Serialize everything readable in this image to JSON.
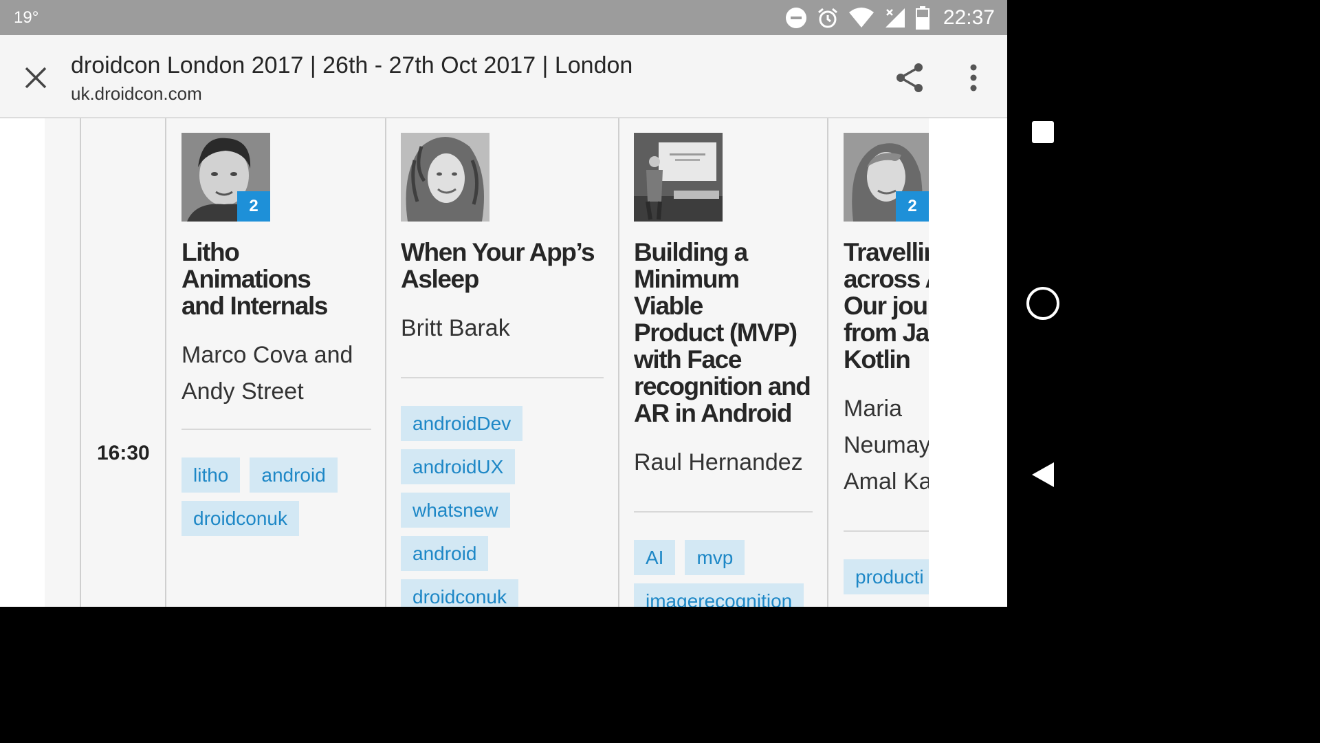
{
  "status_bar": {
    "temperature": "19°",
    "time": "22:37"
  },
  "browser": {
    "title": "droidcon London 2017 | 26th - 27th Oct 2017 | London",
    "url": "uk.droidcon.com"
  },
  "schedule": {
    "time": "16:30",
    "sessions": [
      {
        "title_lines": [
          "Litho Animations",
          "and Internals"
        ],
        "speaker_lines": [
          "Marco Cova and",
          "Andy Street"
        ],
        "badge": "2",
        "tags": [
          "litho",
          "android",
          "droidconuk"
        ]
      },
      {
        "title_lines": [
          "When Your App’s",
          "Asleep"
        ],
        "speaker_lines": [
          "Britt Barak"
        ],
        "badge": "",
        "tags": [
          "androidDev",
          "androidUX",
          "whatsnew",
          "android",
          "droidconuk"
        ]
      },
      {
        "title_lines": [
          "Building a",
          "Minimum Viable",
          "Product (MVP)",
          "with Face",
          "recognition and",
          "AR in Android"
        ],
        "speaker_lines": [
          "Raul Hernandez"
        ],
        "badge": "",
        "tags": [
          "AI",
          "mvp",
          "imagerecognition"
        ]
      },
      {
        "title_lines": [
          "Travellin",
          "across A",
          "Our jour",
          "from Jav",
          "Kotlin"
        ],
        "speaker_lines": [
          "Maria",
          "Neumay",
          "Amal Ka"
        ],
        "badge": "2",
        "tags": [
          "producti"
        ]
      }
    ]
  }
}
